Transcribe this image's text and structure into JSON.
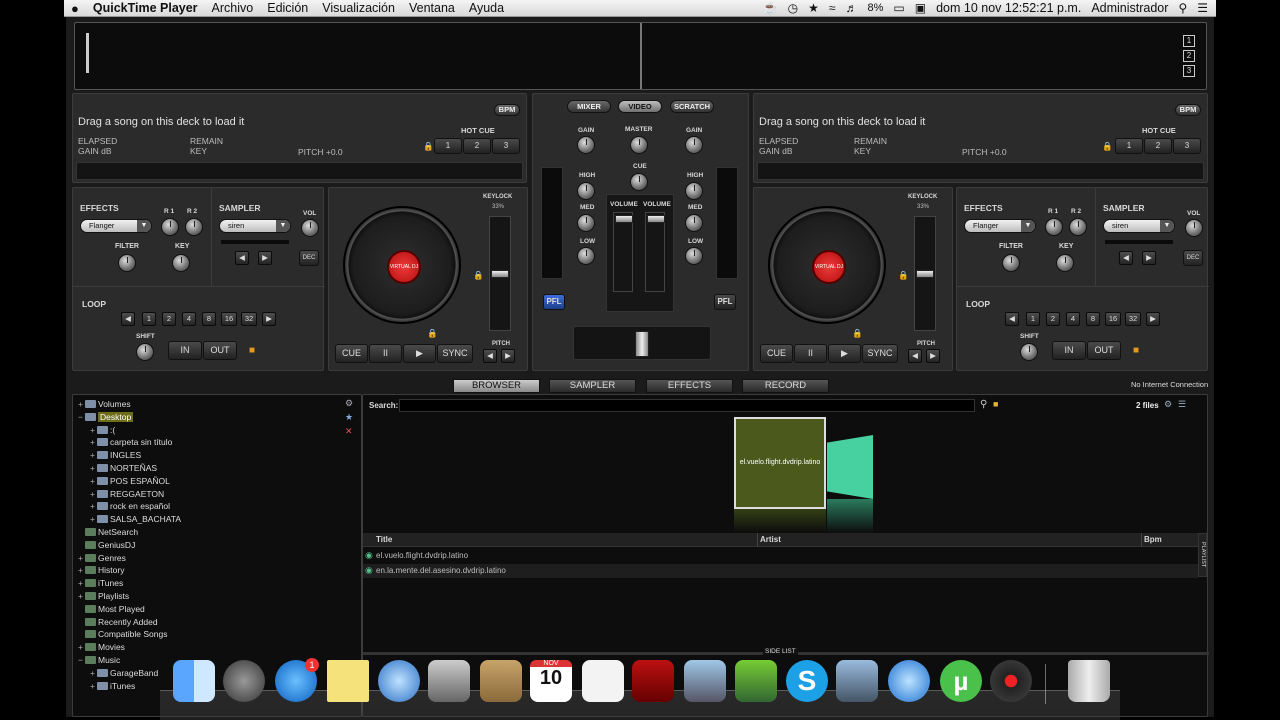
{
  "menubar": {
    "apple": "",
    "app": "QuickTime Player",
    "items": [
      "Archivo",
      "Edición",
      "Visualización",
      "Ventana",
      "Ayuda"
    ],
    "battery": "8%",
    "datetime": "dom 10 nov  12:52:21 p.m.",
    "user": "Administrador"
  },
  "top_display": {
    "deck_numbers": [
      "1",
      "2",
      "3"
    ]
  },
  "deck_left": {
    "title": "Drag a song on this deck to load it",
    "bpm_label": "BPM",
    "elapsed": "ELAPSED",
    "gain_db": "GAIN dB",
    "remain": "REMAIN",
    "key": "KEY",
    "pitch": "PITCH +0.0",
    "hot_cue": "HOT CUE",
    "hot_cue_buttons": [
      "1",
      "2",
      "3"
    ]
  },
  "deck_right": {
    "title": "Drag a song on this deck to load it",
    "bpm_label": "BPM",
    "elapsed": "ELAPSED",
    "gain_db": "GAIN dB",
    "remain": "REMAIN",
    "key": "KEY",
    "pitch": "PITCH +0.0",
    "hot_cue": "HOT CUE",
    "hot_cue_buttons": [
      "1",
      "2",
      "3"
    ]
  },
  "mixer": {
    "tabs": [
      "MIXER",
      "VIDEO",
      "SCRATCH"
    ],
    "gain": "GAIN",
    "master": "MASTER",
    "cue": "CUE",
    "high": "HIGH",
    "med": "MED",
    "low": "LOW",
    "volume": "VOLUME",
    "pfl": "PFL"
  },
  "fx_left": {
    "effects": "EFFECTS",
    "effect_value": "Flanger",
    "r1": "R 1",
    "r2": "R 2",
    "filter": "FILTER",
    "key": "KEY",
    "sampler": "SAMPLER",
    "sampler_value": "siren",
    "vol": "VOL",
    "dec": "DEC",
    "loop": "LOOP",
    "loop_values": [
      "1",
      "2",
      "4",
      "8",
      "16",
      "32"
    ],
    "shift": "SHIFT",
    "in": "IN",
    "out": "OUT"
  },
  "fx_right": {
    "effects": "EFFECTS",
    "effect_value": "Flanger",
    "r1": "R 1",
    "r2": "R 2",
    "filter": "FILTER",
    "key": "KEY",
    "sampler": "SAMPLER",
    "sampler_value": "siren",
    "vol": "VOL",
    "dec": "DEC",
    "loop": "LOOP",
    "loop_values": [
      "1",
      "2",
      "4",
      "8",
      "16",
      "32"
    ],
    "shift": "SHIFT",
    "in": "IN",
    "out": "OUT"
  },
  "turntable_left": {
    "keylock": "KEYLOCK",
    "keylock_pct": "33%",
    "label": "VIRTUAL DJ",
    "pitch": "PITCH",
    "transport": [
      "CUE",
      "II",
      "▶",
      "SYNC"
    ]
  },
  "turntable_right": {
    "keylock": "KEYLOCK",
    "keylock_pct": "33%",
    "label": "VIRTUAL DJ",
    "pitch": "PITCH",
    "transport": [
      "CUE",
      "II",
      "▶",
      "SYNC"
    ]
  },
  "browser": {
    "tabs": [
      "BROWSER",
      "SAMPLER",
      "EFFECTS",
      "RECORD"
    ],
    "connection": "No Internet Connection",
    "search_label": "Search:",
    "files_count": "2 files",
    "cover_title": "el.vuelo.flight.dvdrip.latino",
    "columns": [
      "Title",
      "Artist",
      "Bpm"
    ],
    "rows": [
      {
        "title": "el.vuelo.flight.dvdrip.latino",
        "artist": "",
        "bpm": ""
      },
      {
        "title": "en.la.mente.del.asesino.dvdrip.latino",
        "artist": "",
        "bpm": ""
      }
    ],
    "playlist_tab": "PLAYLIST",
    "side_list": "SIDE LIST"
  },
  "tree": [
    {
      "label": "Volumes",
      "indent": 0,
      "toggle": "+"
    },
    {
      "label": "Desktop",
      "indent": 0,
      "toggle": "−",
      "selected": true
    },
    {
      "label": ":(",
      "indent": 1,
      "toggle": "+"
    },
    {
      "label": "carpeta sin título",
      "indent": 1,
      "toggle": "+"
    },
    {
      "label": "INGLES",
      "indent": 1,
      "toggle": "+"
    },
    {
      "label": "NORTEÑAS",
      "indent": 1,
      "toggle": "+"
    },
    {
      "label": "POS ESPAÑOL",
      "indent": 1,
      "toggle": "+"
    },
    {
      "label": "REGGAETON",
      "indent": 1,
      "toggle": "+"
    },
    {
      "label": "rock en español",
      "indent": 1,
      "toggle": "+"
    },
    {
      "label": "SALSA_BACHATA",
      "indent": 1,
      "toggle": "+"
    },
    {
      "label": "NetSearch",
      "indent": 0,
      "toggle": ""
    },
    {
      "label": "GeniusDJ",
      "indent": 0,
      "toggle": ""
    },
    {
      "label": "Genres",
      "indent": 0,
      "toggle": "+"
    },
    {
      "label": "History",
      "indent": 0,
      "toggle": "+"
    },
    {
      "label": "iTunes",
      "indent": 0,
      "toggle": "+"
    },
    {
      "label": "Playlists",
      "indent": 0,
      "toggle": "+"
    },
    {
      "label": "Most Played",
      "indent": 0,
      "toggle": ""
    },
    {
      "label": "Recently Added",
      "indent": 0,
      "toggle": ""
    },
    {
      "label": "Compatible Songs",
      "indent": 0,
      "toggle": ""
    },
    {
      "label": "Movies",
      "indent": 0,
      "toggle": "+"
    },
    {
      "label": "Music",
      "indent": 0,
      "toggle": "−"
    },
    {
      "label": "GarageBand",
      "indent": 1,
      "toggle": "+"
    },
    {
      "label": "iTunes",
      "indent": 1,
      "toggle": "+"
    }
  ],
  "dock": [
    "finder",
    "launchpad",
    "app-store",
    "stickies",
    "safari",
    "facetime",
    "contacts",
    "calendar",
    "reminders",
    "photo-booth",
    "iphoto",
    "game",
    "skype",
    "preview",
    "quicktime",
    "utorrent",
    "virtualdj",
    "trash"
  ],
  "dock_calendar": {
    "month": "NOV",
    "day": "10"
  },
  "dock_badge": "1"
}
